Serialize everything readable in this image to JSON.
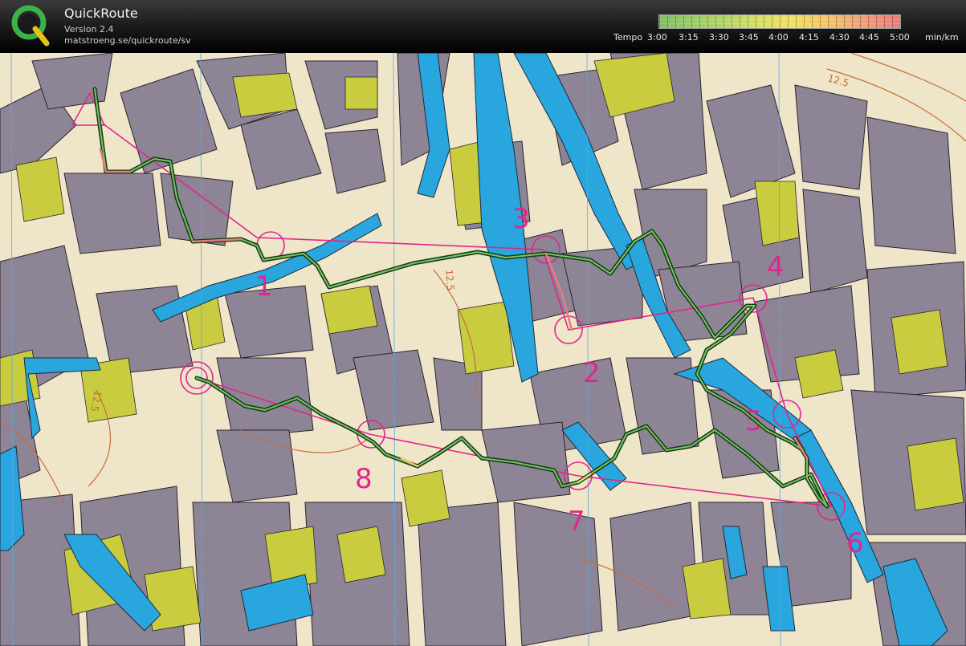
{
  "app": {
    "title": "QuickRoute",
    "version": "Version 2.4",
    "url": "matstroeng.se/quickroute/sv",
    "logo_letter": "Q"
  },
  "tempo_legend": {
    "label": "Tempo",
    "ticks": [
      "3:00",
      "3:15",
      "3:30",
      "3:45",
      "4:00",
      "4:15",
      "4:30",
      "4:45",
      "5:00"
    ],
    "unit": "min/km",
    "colors": {
      "fast": "#7fbf6a",
      "mid": "#f0e06a",
      "slow": "#e97c7c"
    }
  },
  "map": {
    "control_numbers": [
      "1",
      "2",
      "3",
      "4",
      "5",
      "6",
      "7",
      "8"
    ],
    "contour_labels": [
      "12.5",
      "12.5",
      "12.5"
    ],
    "colors": {
      "building": "#8d8495",
      "yellow_area": "#c9cc3e",
      "water": "#28a6dd",
      "course": "#e0268e",
      "route": "#1f6b1f",
      "background": "#efe5c8"
    }
  }
}
